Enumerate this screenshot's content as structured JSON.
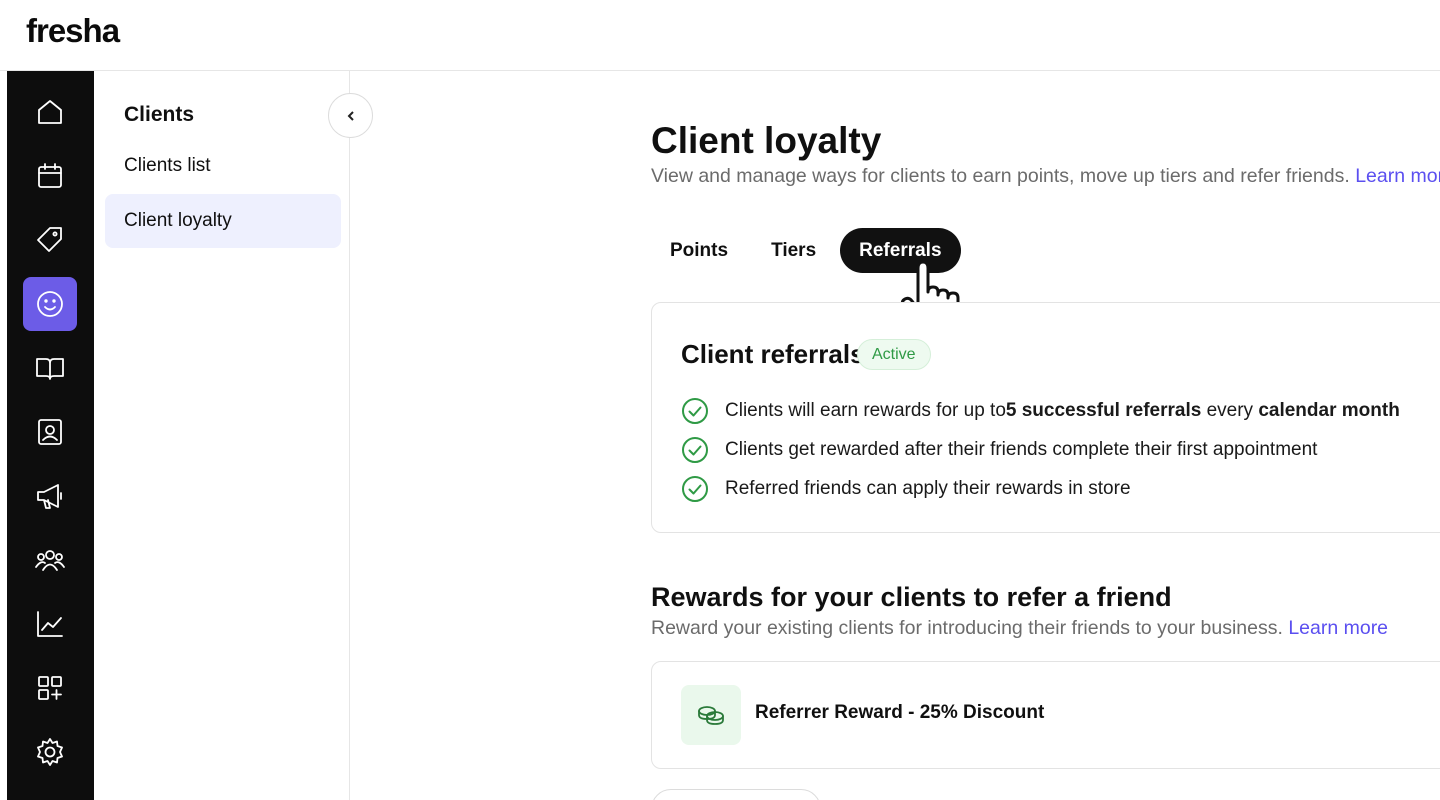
{
  "app": {
    "logo": "fresha"
  },
  "rail": {
    "items": [
      {
        "icon": "home-icon",
        "active": false
      },
      {
        "icon": "calendar-icon",
        "active": false
      },
      {
        "icon": "tag-icon",
        "active": false
      },
      {
        "icon": "smiley-icon",
        "active": true
      },
      {
        "icon": "book-icon",
        "active": false
      },
      {
        "icon": "contact-card-icon",
        "active": false
      },
      {
        "icon": "megaphone-icon",
        "active": false
      },
      {
        "icon": "team-icon",
        "active": false
      },
      {
        "icon": "chart-icon",
        "active": false
      },
      {
        "icon": "add-apps-icon",
        "active": false
      },
      {
        "icon": "gear-icon",
        "active": false
      }
    ],
    "accent": "#6c5ce7"
  },
  "subnav": {
    "title": "Clients",
    "items": [
      {
        "label": "Clients list",
        "active": false
      },
      {
        "label": "Client loyalty",
        "active": true
      }
    ]
  },
  "main": {
    "title": "Client loyalty",
    "subtitle": "View and manage ways for clients to earn points, move up tiers and refer friends.",
    "subtitle_link": "Learn more",
    "tabs": [
      {
        "label": "Points",
        "active": false
      },
      {
        "label": "Tiers",
        "active": false
      },
      {
        "label": "Referrals",
        "active": true
      }
    ],
    "referrals_card": {
      "title": "Client referrals",
      "status": "Active",
      "rules": {
        "r1_a": "Clients will earn rewards for up to ",
        "r1_b": "5 successful referrals",
        "r1_c": " every ",
        "r1_d": "calendar month",
        "r2": "Clients get rewarded after their friends complete their first appointment",
        "r3": "Referred friends can apply their rewards in store"
      }
    },
    "rewards_section": {
      "title": "Rewards for your clients to refer a friend",
      "subtitle": "Reward your existing clients for introducing their friends to your business.",
      "subtitle_link": "Learn more",
      "reward": {
        "icon": "coins-icon",
        "label": "Referrer Reward - 25% Discount"
      }
    }
  },
  "colors": {
    "link": "#5b4ff0",
    "active_green": "#2f9a45",
    "tab_active_bg": "#111111"
  }
}
